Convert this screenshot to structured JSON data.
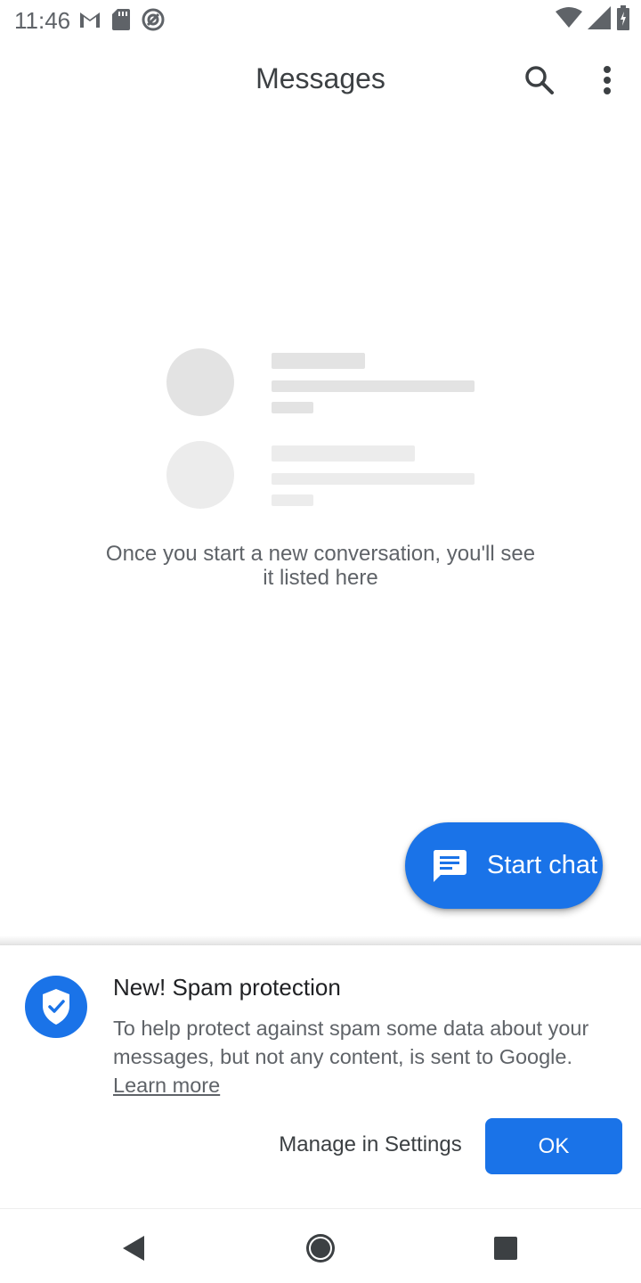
{
  "status_bar": {
    "time": "11:46",
    "left_icons": [
      "gmail-icon",
      "sd-card-icon",
      "sync-icon"
    ],
    "right_icons": [
      "wifi-icon",
      "signal-icon",
      "battery-icon"
    ]
  },
  "app_bar": {
    "title": "Messages",
    "icons": [
      "search-icon",
      "more-vert-icon"
    ]
  },
  "empty_state": {
    "message": "Once you start a new conversation, you'll see it listed here"
  },
  "fab": {
    "label": "Start chat",
    "icon": "chat-bubble-icon",
    "color": "#1a73e8"
  },
  "spam_sheet": {
    "title": "New! Spam protection",
    "body": "To help protect against spam some data about your messages, but not any content, is sent to Google.",
    "link_label": "Learn more",
    "manage_label": "Manage in Settings",
    "ok_label": "OK",
    "icon": "shield-check-icon",
    "accent": "#1a73e8"
  },
  "nav_bar": {
    "icons": [
      "back-icon",
      "home-icon",
      "recents-icon"
    ]
  }
}
